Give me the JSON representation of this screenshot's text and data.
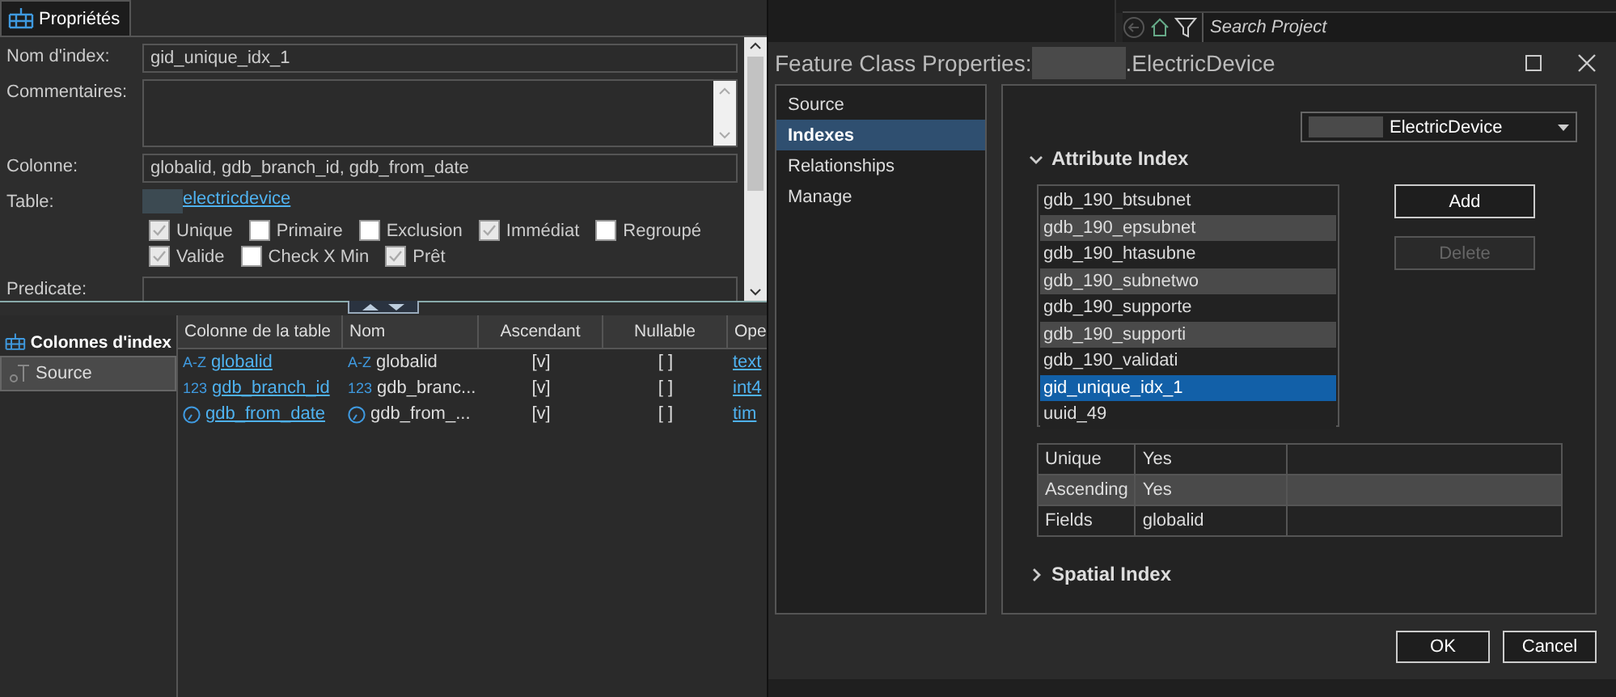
{
  "properties_panel": {
    "tab": {
      "label": "Propriétés",
      "selected": true
    },
    "index_name": {
      "label": "Nom d'index:",
      "value": "gid_unique_idx_1"
    },
    "comments": {
      "label": "Commentaires:"
    },
    "column": {
      "label": "Colonne:",
      "value": "globalid, gdb_branch_id, gdb_from_date"
    },
    "table": {
      "label": "Table:",
      "link": "electricdevice"
    },
    "options": [
      {
        "label": "Unique",
        "checked": true
      },
      {
        "label": "Primaire",
        "checked": false
      },
      {
        "label": "Exclusion",
        "checked": false
      },
      {
        "label": "Immédiat",
        "checked": true
      },
      {
        "label": "Regroupé",
        "checked": false
      },
      {
        "label": "Valide",
        "checked": true
      },
      {
        "label": "Check X Min",
        "checked": false
      },
      {
        "label": "Prêt",
        "checked": true
      }
    ],
    "predicate": {
      "label": "Predicate:"
    }
  },
  "index_columns": {
    "section_title": "Colonnes d'index",
    "items": [
      {
        "label": "Source",
        "selected": true
      }
    ],
    "columns": [
      "Colonne de la table",
      "Nom",
      "Ascendant",
      "Nullable",
      "Ope"
    ],
    "rows": [
      {
        "kind": "text",
        "column": {
          "glyph": "A-Z",
          "text": "globalid"
        },
        "name": {
          "glyph": "A-Z",
          "text": "globalid"
        },
        "ascending": "[v]",
        "nullable": "[ ]",
        "column_5": "text"
      },
      {
        "kind": "number",
        "column": {
          "glyph": "123",
          "text": "gdb_branch_id"
        },
        "name": {
          "glyph": "123",
          "text": "gdb_branc..."
        },
        "ascending": "[v]",
        "nullable": "[ ]",
        "column_5": "int4"
      },
      {
        "kind": "date",
        "column": {
          "text": "gdb_from_date"
        },
        "name": {
          "text": "gdb_from_..."
        },
        "ascending": "[v]",
        "nullable": "[ ]",
        "column_5": "tim"
      }
    ]
  },
  "search": {
    "placeholder": "Search Project"
  },
  "dialog": {
    "title": "Feature Class Properties:",
    "title_name": ".ElectricDevice",
    "nav": [
      {
        "label": "Source",
        "selected": false
      },
      {
        "label": "Indexes",
        "selected": true
      },
      {
        "label": "Relationships",
        "selected": false
      },
      {
        "label": "Manage",
        "selected": false
      }
    ],
    "dataset_dropdown": {
      "value": "ElectricDevice"
    },
    "attribute_index": {
      "title": "Attribute Index",
      "expanded": true,
      "indexes": [
        {
          "name": "gdb_190_btsubnet",
          "selected": false
        },
        {
          "name": "gdb_190_epsubnet",
          "selected": false
        },
        {
          "name": "gdb_190_htasubne",
          "selected": false
        },
        {
          "name": "gdb_190_subnetwo",
          "selected": false
        },
        {
          "name": "gdb_190_supporte",
          "selected": false
        },
        {
          "name": "gdb_190_supporti",
          "selected": false
        },
        {
          "name": "gdb_190_validati",
          "selected": false
        },
        {
          "name": "gid_unique_idx_1",
          "selected": true
        },
        {
          "name": "uuid_49",
          "selected": false
        }
      ],
      "buttons": [
        {
          "label": "Add",
          "disabled": false
        },
        {
          "label": "Delete",
          "disabled": true
        }
      ],
      "details": [
        {
          "label": "Unique",
          "value": "Yes"
        },
        {
          "label": "Ascending",
          "value": "Yes"
        },
        {
          "label": "Fields",
          "value": "globalid"
        }
      ]
    },
    "spatial_index": {
      "title": "Spatial Index",
      "expanded": false
    },
    "buttons": [
      "OK",
      "Cancel"
    ]
  }
}
